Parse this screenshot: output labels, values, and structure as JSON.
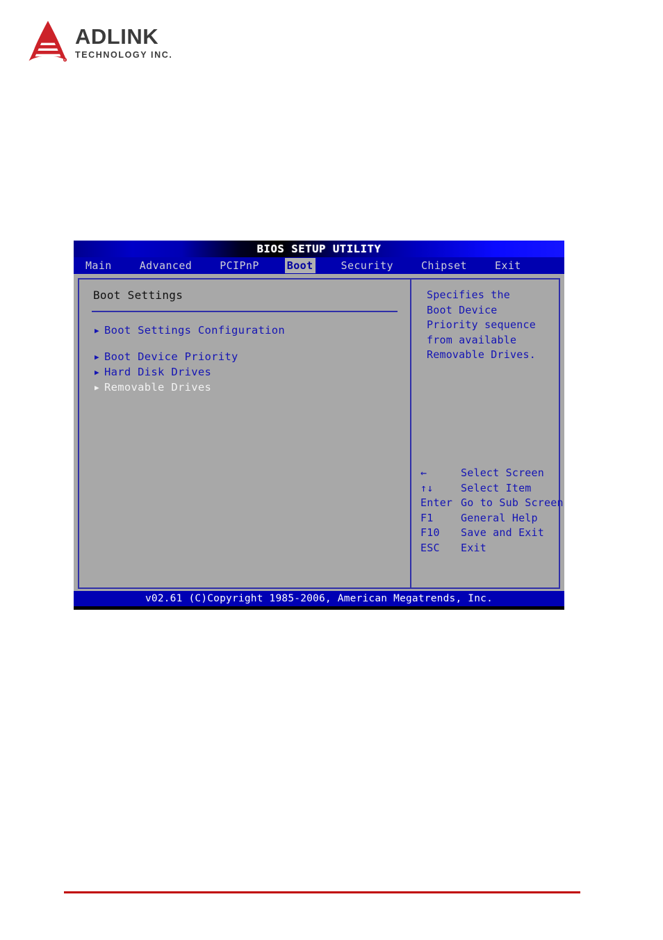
{
  "brand": {
    "logo_icon": "adlink-triangle-logo",
    "name": "ADLINK",
    "tagline": "TECHNOLOGY INC."
  },
  "bios": {
    "title": "BIOS SETUP UTILITY",
    "menu_tabs": [
      {
        "label": "Main",
        "selected": false
      },
      {
        "label": "Advanced",
        "selected": false
      },
      {
        "label": "PCIPnP",
        "selected": false
      },
      {
        "label": "Boot",
        "selected": true
      },
      {
        "label": "Security",
        "selected": false
      },
      {
        "label": "Chipset",
        "selected": false
      },
      {
        "label": "Exit",
        "selected": false
      }
    ],
    "left_panel": {
      "section_title": "Boot Settings",
      "group_one": [
        {
          "arrow": "▶",
          "label": "Boot Settings Configuration",
          "highlighted": false
        }
      ],
      "group_two": [
        {
          "arrow": "▶",
          "label": "Boot Device Priority",
          "highlighted": false
        },
        {
          "arrow": "▶",
          "label": "Hard Disk Drives",
          "highlighted": false
        },
        {
          "arrow": "▶",
          "label": "Removable Drives",
          "highlighted": true
        }
      ]
    },
    "right_panel": {
      "help_lines": [
        "Specifies the",
        "Boot Device",
        "Priority sequence",
        "from available",
        "Removable Drives."
      ],
      "legend": [
        {
          "key": "←",
          "desc": "Select Screen"
        },
        {
          "key": "↑↓",
          "desc": "Select Item"
        },
        {
          "key": "Enter",
          "desc": "Go to Sub Screen"
        },
        {
          "key": "F1",
          "desc": "General Help"
        },
        {
          "key": "F10",
          "desc": "Save and Exit"
        },
        {
          "key": "ESC",
          "desc": "Exit"
        }
      ]
    },
    "footer": "v02.61 (C)Copyright 1985-2006, American Megatrends, Inc."
  },
  "colors": {
    "bios_blue": "#0000b4",
    "text_blue": "#1414b4",
    "panel_gray": "#a8a8a8",
    "highlight_white": "#f2f2f2",
    "tab_selected_bg": "#b0b0b0",
    "footer_rule_red": "#c00000",
    "logo_red": "#cc2229"
  }
}
